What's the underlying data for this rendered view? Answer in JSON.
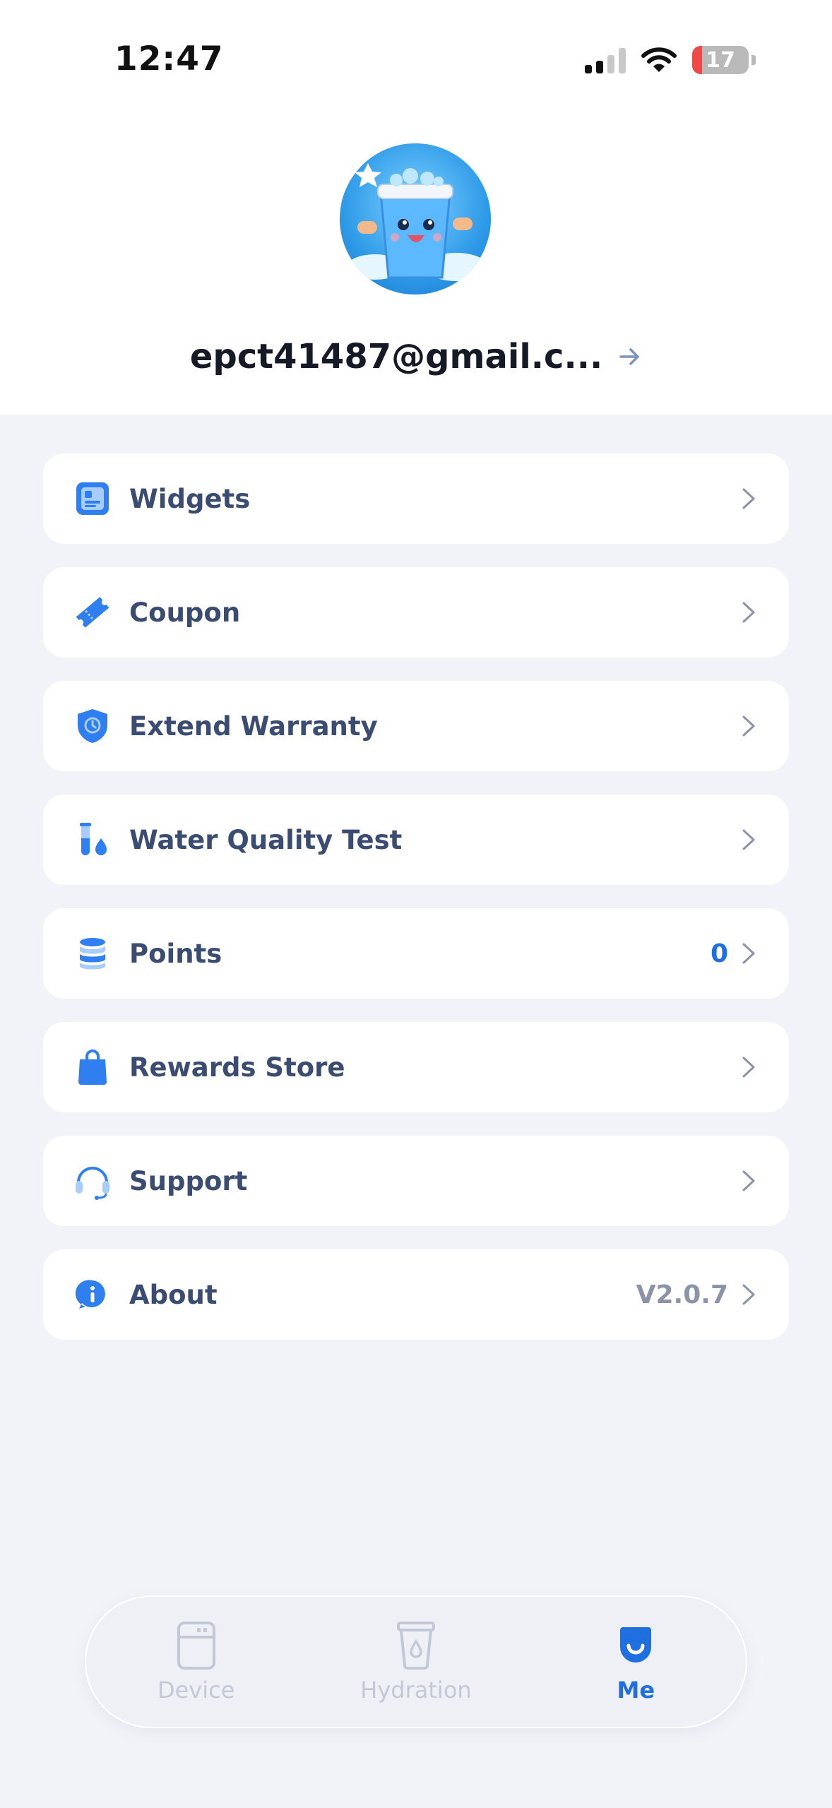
{
  "status_bar": {
    "time": "12:47",
    "battery_level": "17"
  },
  "profile": {
    "email": "epct41487@gmail.c...",
    "avatar_icon": "water-cup-mascot-icon"
  },
  "menu": {
    "items": [
      {
        "label": "Widgets",
        "icon": "widgets-icon",
        "value": ""
      },
      {
        "label": "Coupon",
        "icon": "coupon-icon",
        "value": ""
      },
      {
        "label": "Extend Warranty",
        "icon": "shield-icon",
        "value": ""
      },
      {
        "label": "Water Quality Test",
        "icon": "test-tube-drop-icon",
        "value": ""
      },
      {
        "label": "Points",
        "icon": "coins-icon",
        "value": "0"
      },
      {
        "label": "Rewards Store",
        "icon": "shopping-bag-icon",
        "value": ""
      },
      {
        "label": "Support",
        "icon": "headset-icon",
        "value": ""
      },
      {
        "label": "About",
        "icon": "info-icon",
        "value": "V2.0.7"
      }
    ]
  },
  "tabbar": {
    "tabs": [
      {
        "label": "Device",
        "icon": "device-icon",
        "active": false
      },
      {
        "label": "Hydration",
        "icon": "cup-icon",
        "active": false
      },
      {
        "label": "Me",
        "icon": "me-icon",
        "active": true
      }
    ]
  },
  "colors": {
    "accent": "#1f6fe0",
    "icon_blue": "#2f7ff0",
    "background": "#f2f3f8",
    "battery_low": "#ef4a48"
  }
}
